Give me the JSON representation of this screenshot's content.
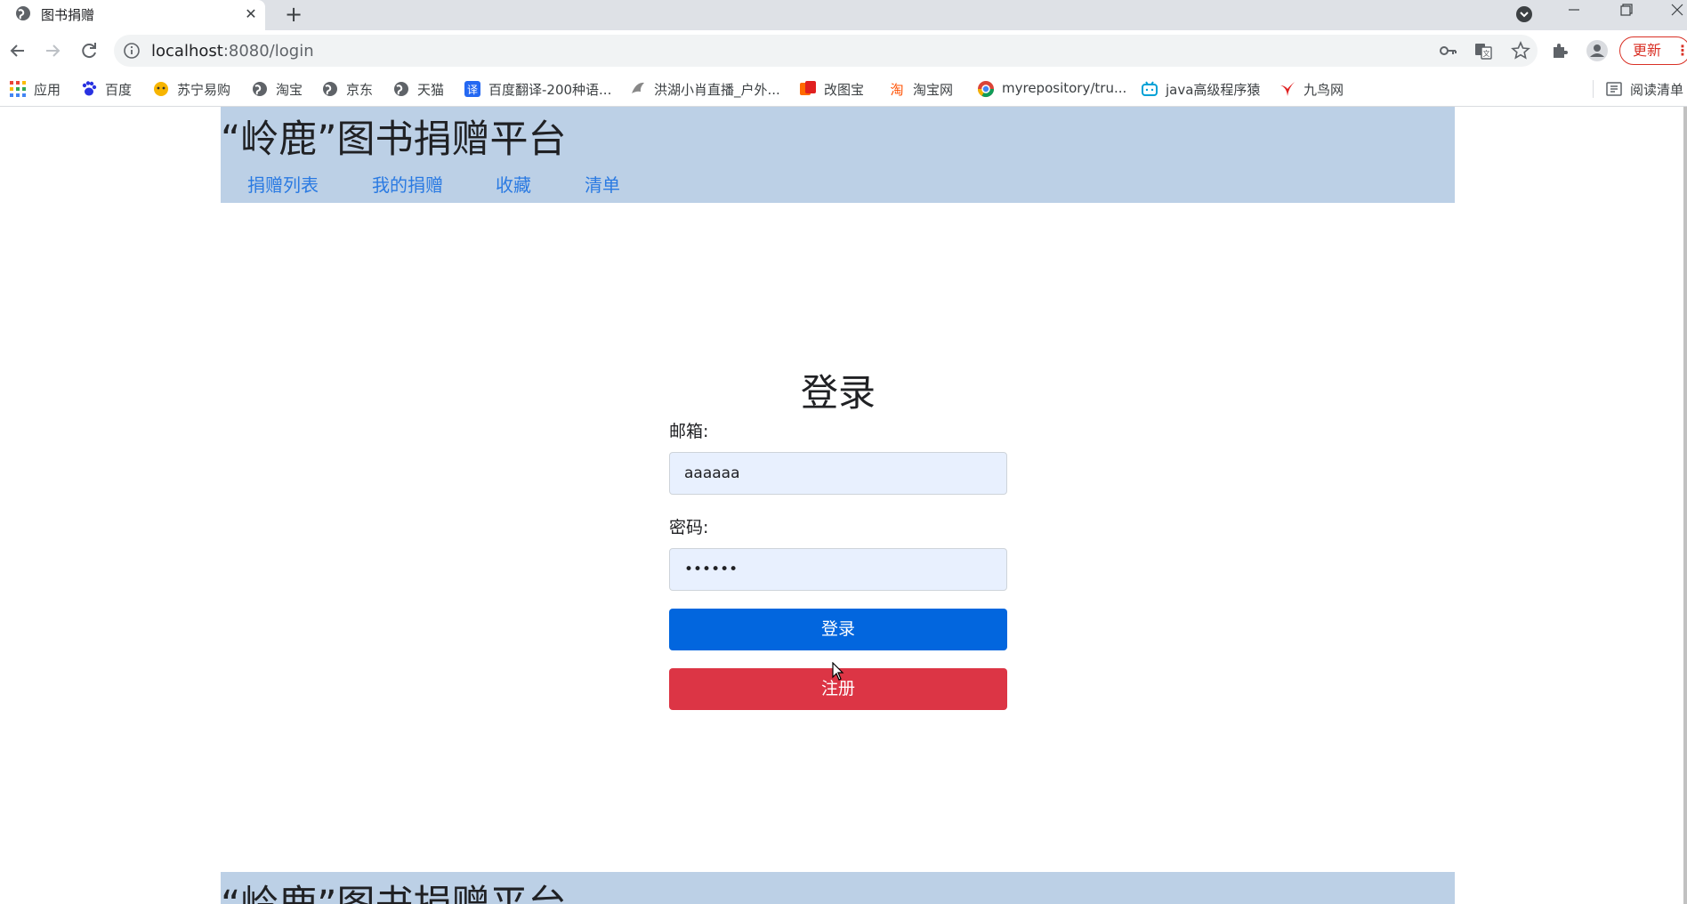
{
  "browser": {
    "tab_title": "图书捐赠",
    "url_host": "localhost",
    "url_path": ":8080/login",
    "update_label": "更新",
    "bookmarks": [
      {
        "label": "应用",
        "icon": "apps-grid-icon"
      },
      {
        "label": "百度",
        "icon": "baidu-paw-icon"
      },
      {
        "label": "苏宁易购",
        "icon": "suning-icon"
      },
      {
        "label": "淘宝",
        "icon": "globe-icon"
      },
      {
        "label": "京东",
        "icon": "globe-icon"
      },
      {
        "label": "天猫",
        "icon": "globe-icon"
      },
      {
        "label": "百度翻译-200种语...",
        "icon": "translate-icon"
      },
      {
        "label": "洪湖小肖直播_户外...",
        "icon": "bird-icon"
      },
      {
        "label": "改图宝",
        "icon": "gaitubao-icon"
      },
      {
        "label": "淘宝网",
        "icon": "taobao-icon"
      },
      {
        "label": "myrepository/tru...",
        "icon": "chrome-icon"
      },
      {
        "label": "java高级程序猿",
        "icon": "bilibili-icon"
      },
      {
        "label": "九鸟网",
        "icon": "bird-red-icon"
      }
    ],
    "reading_list_label": "阅读清单"
  },
  "site": {
    "title": "“岭鹿”图书捐赠平台",
    "nav": [
      "捐赠列表",
      "我的捐赠",
      "收藏",
      "清单"
    ]
  },
  "login": {
    "heading": "登录",
    "email_label": "邮箱:",
    "email_value": "aaaaaa",
    "password_label": "密码:",
    "password_value": "••••••",
    "login_button": "登录",
    "register_button": "注册"
  },
  "colors": {
    "header_bg": "#bcd0e6",
    "nav_link": "#2a7ae2",
    "primary": "#0266de",
    "danger": "#dc3545",
    "input_bg": "#e8f0fe"
  }
}
